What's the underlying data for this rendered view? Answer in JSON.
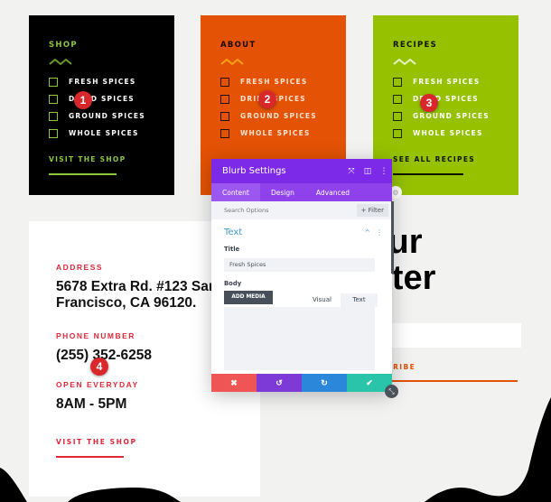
{
  "cards": [
    {
      "title": "SHOP",
      "items": [
        "FRESH SPICES",
        "DRIED SPICES",
        "GROUND SPICES",
        "WHOLE SPICES"
      ],
      "link": "VISIT THE SHOP",
      "background": "#000000",
      "accent": "#8cc63f"
    },
    {
      "title": "ABOUT",
      "items": [
        "FRESH SPICES",
        "DRIED SPICES",
        "GROUND SPICES",
        "WHOLE SPICES"
      ],
      "background": "#e35205",
      "accent": "#f7a318"
    },
    {
      "title": "RECIPES",
      "items": [
        "FRESH SPICES",
        "DRIED SPICES",
        "GROUND SPICES",
        "WHOLE SPICES"
      ],
      "link": "SEE ALL RECIPES",
      "background": "#95c100",
      "accent": "#e8f2c8"
    }
  ],
  "badges": [
    "1",
    "2",
    "3",
    "4"
  ],
  "contact": {
    "address_label": "ADDRESS",
    "address_line1": "5678 Extra Rd. #123 San",
    "address_line2": "Francisco, CA 96120.",
    "phone_label": "PHONE NUMBER",
    "phone": "(255) 352-6258",
    "hours_label": "OPEN EVERYDAY",
    "hours": "8AM - 5PM",
    "link": "VISIT THE SHOP"
  },
  "newsletter": {
    "heading_line1": "Our",
    "heading_line2": "etter",
    "subscribe": "SUBSCRIBE"
  },
  "modal": {
    "title": "Blurb Settings",
    "header_icons": [
      "expand-icon",
      "sidebar-icon",
      "more-icon"
    ],
    "tabs": [
      "Content",
      "Design",
      "Advanced"
    ],
    "active_tab": "Content",
    "search_placeholder": "Search Options",
    "filter_label": "+ Filter",
    "section_title": "Text",
    "title_label": "Title",
    "title_value": "Fresh Spices",
    "body_label": "Body",
    "add_media_label": "ADD MEDIA",
    "editor_tabs": [
      "Visual",
      "Text"
    ],
    "footer": {
      "close": "✖",
      "undo": "↺",
      "redo": "↻",
      "save": "✔"
    },
    "colors": {
      "header": "#7d2ae8",
      "close": "#ef5555",
      "undo": "#7d3ad7",
      "redo": "#2b87da",
      "save": "#29c4a9"
    }
  }
}
